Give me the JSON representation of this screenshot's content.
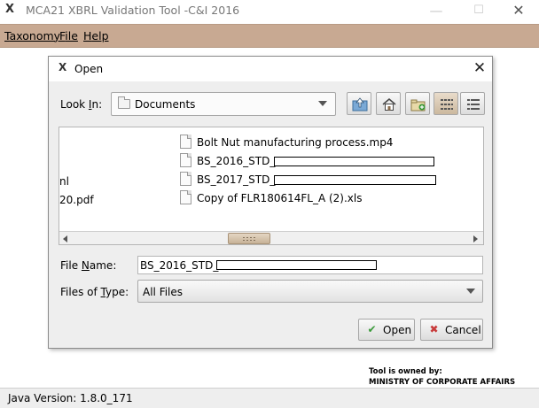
{
  "window": {
    "title": "MCA21 XBRL Validation Tool -C&I 2016",
    "icon": "x-logo-icon",
    "controls": {
      "minimize": "—",
      "maximize": "☐",
      "close": "✕"
    }
  },
  "menubar": {
    "taxonomy": {
      "mnemonic": "T",
      "rest": "axonomy"
    },
    "file": {
      "mnemonic": "F",
      "rest": "ile"
    },
    "help": {
      "mnemonic": "H",
      "rest": "elp"
    }
  },
  "owner": {
    "line1": "Tool is owned by:",
    "line2": "MINISTRY OF CORPORATE AFFAIRS"
  },
  "status": {
    "text": "Java Version: 1.8.0_171"
  },
  "dialog": {
    "title": "Open",
    "look_in": {
      "label_pre": "Look ",
      "label_mn": "I",
      "label_post": "n:",
      "value": "Documents"
    },
    "toolbar_icons": [
      "up-folder-icon",
      "home-icon",
      "new-folder-icon",
      "list-view-icon",
      "details-view-icon"
    ],
    "files_partial": [
      "nl",
      "20.pdf"
    ],
    "files": [
      {
        "name": "Bolt Nut manufacturing process.mp4",
        "redacted": false
      },
      {
        "name": "BS_2016_STD_",
        "redacted": true
      },
      {
        "name": "BS_2017_STD_",
        "redacted": true
      },
      {
        "name": "Copy of FLR180614FL_A (2).xls",
        "redacted": false
      }
    ],
    "file_name": {
      "label_pre": "File ",
      "label_mn": "N",
      "label_post": "ame:",
      "value": "BS_2016_STD_"
    },
    "files_of_type": {
      "label_pre": "Files of ",
      "label_mn": "T",
      "label_post": "ype:",
      "value": "All Files"
    },
    "buttons": {
      "open": "Open",
      "cancel": "Cancel"
    },
    "colors": {
      "accent": "#c8a992",
      "open_check": "#3a9a3a",
      "cancel_x": "#c83a3a"
    }
  }
}
